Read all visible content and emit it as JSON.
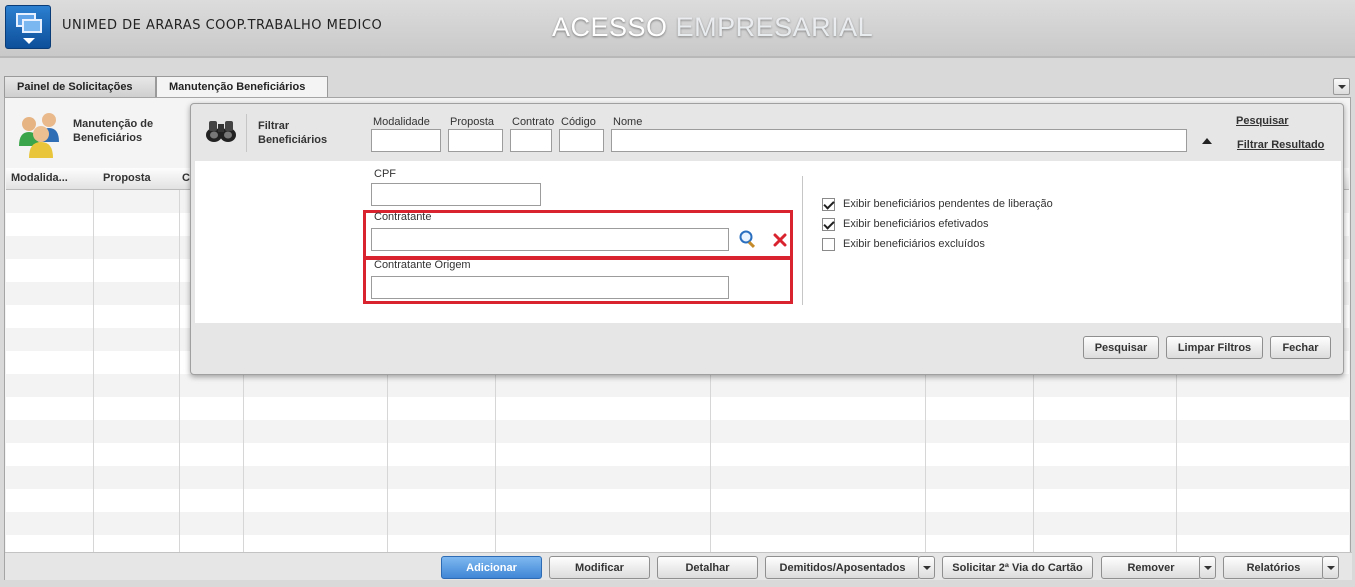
{
  "header": {
    "company": "UNIMED DE ARARAS COOP.TRABALHO MEDICO",
    "brand_part1": "ACESSO",
    "brand_part2": "EMPRESARIAL"
  },
  "tabs": [
    {
      "label": "Painel de Solicitações"
    },
    {
      "label": "Manutenção Beneficiários"
    }
  ],
  "page": {
    "title": "Manutenção de Beneficiários"
  },
  "grid": {
    "columns": [
      "Modalida...",
      "Proposta",
      "C"
    ]
  },
  "filter": {
    "title": "Filtrar Beneficiários",
    "fields": {
      "modalidade": {
        "label": "Modalidade",
        "value": ""
      },
      "proposta": {
        "label": "Proposta",
        "value": ""
      },
      "contrato": {
        "label": "Contrato",
        "value": ""
      },
      "codigo": {
        "label": "Código",
        "value": ""
      },
      "nome": {
        "label": "Nome",
        "value": ""
      },
      "cpf": {
        "label": "CPF",
        "value": ""
      },
      "contratante": {
        "label": "Contratante",
        "value": ""
      },
      "contratante_origem": {
        "label": "Contratante Origem",
        "value": ""
      }
    },
    "links": {
      "pesquisar": "Pesquisar",
      "filtrar_resultado": "Filtrar Resultado"
    },
    "checkboxes": [
      {
        "label": "Exibir beneficiários pendentes de liberação",
        "checked": true
      },
      {
        "label": "Exibir beneficiários efetivados",
        "checked": true
      },
      {
        "label": "Exibir beneficiários excluídos",
        "checked": false
      }
    ],
    "buttons": {
      "pesquisar": "Pesquisar",
      "limpar": "Limpar Filtros",
      "fechar": "Fechar"
    }
  },
  "actions": {
    "adicionar": "Adicionar",
    "modificar": "Modificar",
    "detalhar": "Detalhar",
    "demitidos": "Demitidos/Aposentados",
    "segunda_via": "Solicitar 2ª Via do Cartão",
    "remover": "Remover",
    "relatorios": "Relatórios"
  },
  "colors": {
    "highlight": "#d9232f",
    "primary_button": "#3f86d6"
  }
}
